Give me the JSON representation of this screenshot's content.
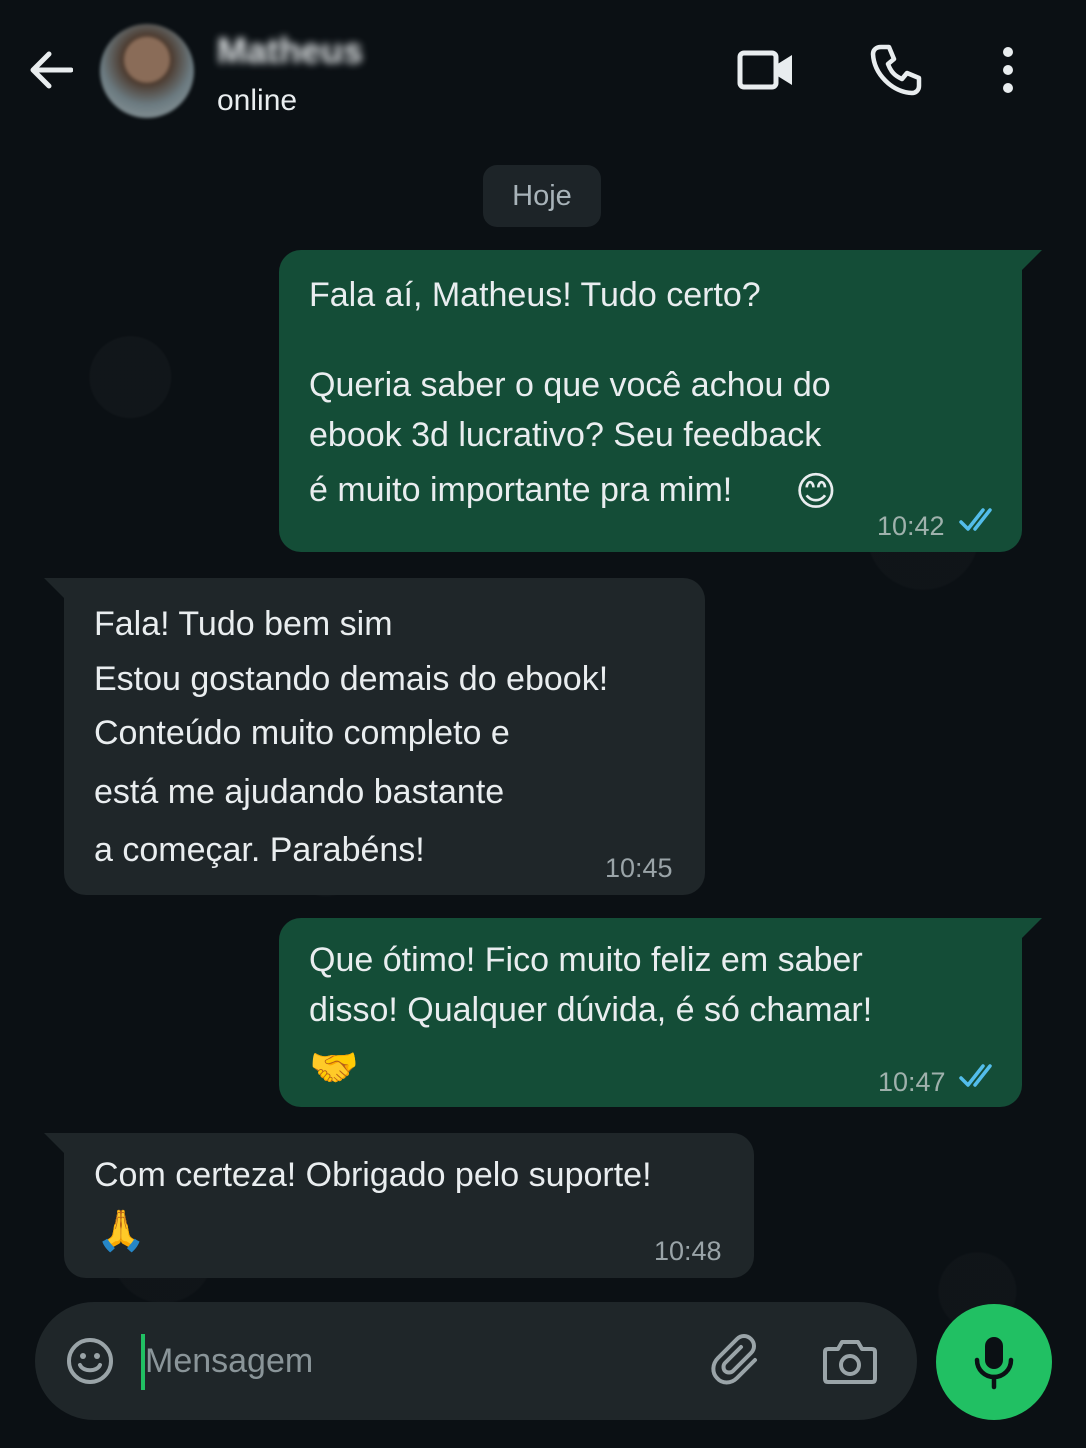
{
  "header": {
    "contact_name": "Matheus",
    "contact_status": "online",
    "icons": [
      "back-arrow-icon",
      "video-call-icon",
      "voice-call-icon",
      "more-options-icon"
    ]
  },
  "date_chip": "Hoje",
  "messages": [
    {
      "direction": "outgoing",
      "lines": [
        "Fala aí, Matheus! Tudo certo?",
        "Queria saber o que você achou do",
        "ebook 3d lucrativo? Seu feedback",
        "é muito importante pra mim!"
      ],
      "emoji": "😊",
      "time": "10:42",
      "status": "read"
    },
    {
      "direction": "incoming",
      "lines": [
        "Fala! Tudo bem sim",
        "Estou gostando demais do ebook!",
        "Conteúdo muito completo e",
        "está me ajudando bastante",
        "a começar. Parabéns!"
      ],
      "time": "10:45"
    },
    {
      "direction": "outgoing",
      "lines": [
        "Que ótimo! Fico muito feliz em saber",
        "disso! Qualquer dúvida, é só chamar!"
      ],
      "emoji": "🤝",
      "time": "10:47",
      "status": "read"
    },
    {
      "direction": "incoming",
      "lines": [
        "Com certeza! Obrigado pelo suporte!"
      ],
      "emoji": "🙏",
      "time": "10:48"
    }
  ],
  "composer": {
    "placeholder": "Mensagem",
    "value": "",
    "icons": [
      "emoji-icon",
      "attach-icon",
      "camera-icon",
      "microphone-icon"
    ]
  },
  "colors": {
    "background": "#0b1014",
    "outgoing_bubble": "#144d37",
    "incoming_bubble": "#1f2629",
    "accent_green": "#21c063",
    "read_ticks": "#53bdeb"
  }
}
